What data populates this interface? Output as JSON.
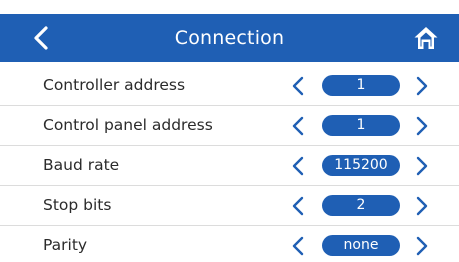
{
  "header": {
    "title": "Connection",
    "back_icon": "chevron-left-icon",
    "home_icon": "home-icon"
  },
  "colors": {
    "accent": "#1f5fb4",
    "text": "#2b2b2b",
    "divider": "#dcdcdc"
  },
  "rows": [
    {
      "label": "Controller address",
      "value": "1"
    },
    {
      "label": "Control panel address",
      "value": "1"
    },
    {
      "label": "Baud rate",
      "value": "115200"
    },
    {
      "label": "Stop bits",
      "value": "2"
    },
    {
      "label": "Parity",
      "value": "none"
    }
  ]
}
